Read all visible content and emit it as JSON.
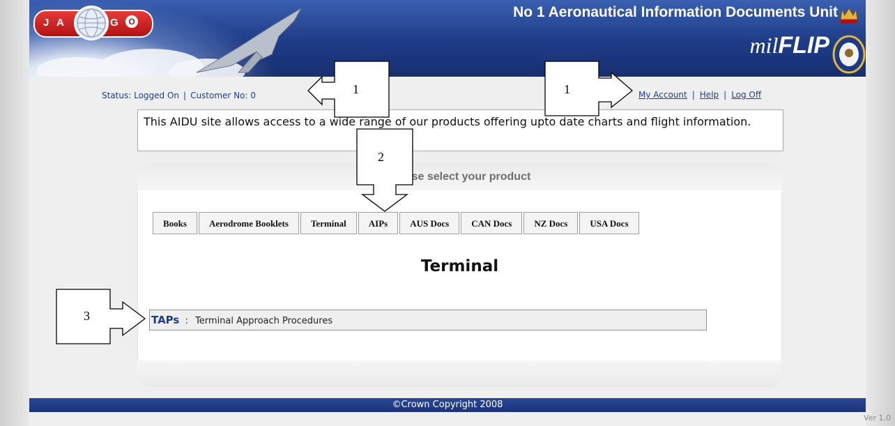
{
  "header": {
    "logo_letters": [
      "J",
      "A",
      "G",
      "O"
    ],
    "title": "No 1 Aeronautical Information Documents Unit",
    "brand_mil": "mil",
    "brand_flip": "FLIP",
    "brand_color": "#1e3b86"
  },
  "status": {
    "status_text": "Status: Logged On",
    "separator": "|",
    "customer_text": "Customer No: 0"
  },
  "account_links": {
    "my_account": "My Account",
    "help": "Help",
    "log_off": "Log Off",
    "separator": "|"
  },
  "info": {
    "text": "This AIDU site allows access to a wide range of our products offering upto date charts and flight information."
  },
  "panel": {
    "heading": "Please select your product",
    "tabs": [
      {
        "label": "Books"
      },
      {
        "label": "Aerodrome Booklets"
      },
      {
        "label": "Terminal"
      },
      {
        "label": "AIPs"
      },
      {
        "label": "AUS Docs"
      },
      {
        "label": "CAN Docs"
      },
      {
        "label": "NZ Docs"
      },
      {
        "label": "USA Docs"
      }
    ],
    "active_tab": "Terminal",
    "section_title": "Terminal",
    "items": [
      {
        "key": "TAPs",
        "colon": ":",
        "description": "Terminal Approach Procedures"
      }
    ]
  },
  "footer": {
    "copyright": "©Crown Copyright 2008",
    "version": "Ver 1.0"
  },
  "callouts": {
    "one_left": "1",
    "one_right": "1",
    "two": "2",
    "three": "3"
  },
  "colors": {
    "link_blue": "#1f3c8a",
    "footer_blue": "#1c347a",
    "panel_bg": "#ffffff"
  }
}
